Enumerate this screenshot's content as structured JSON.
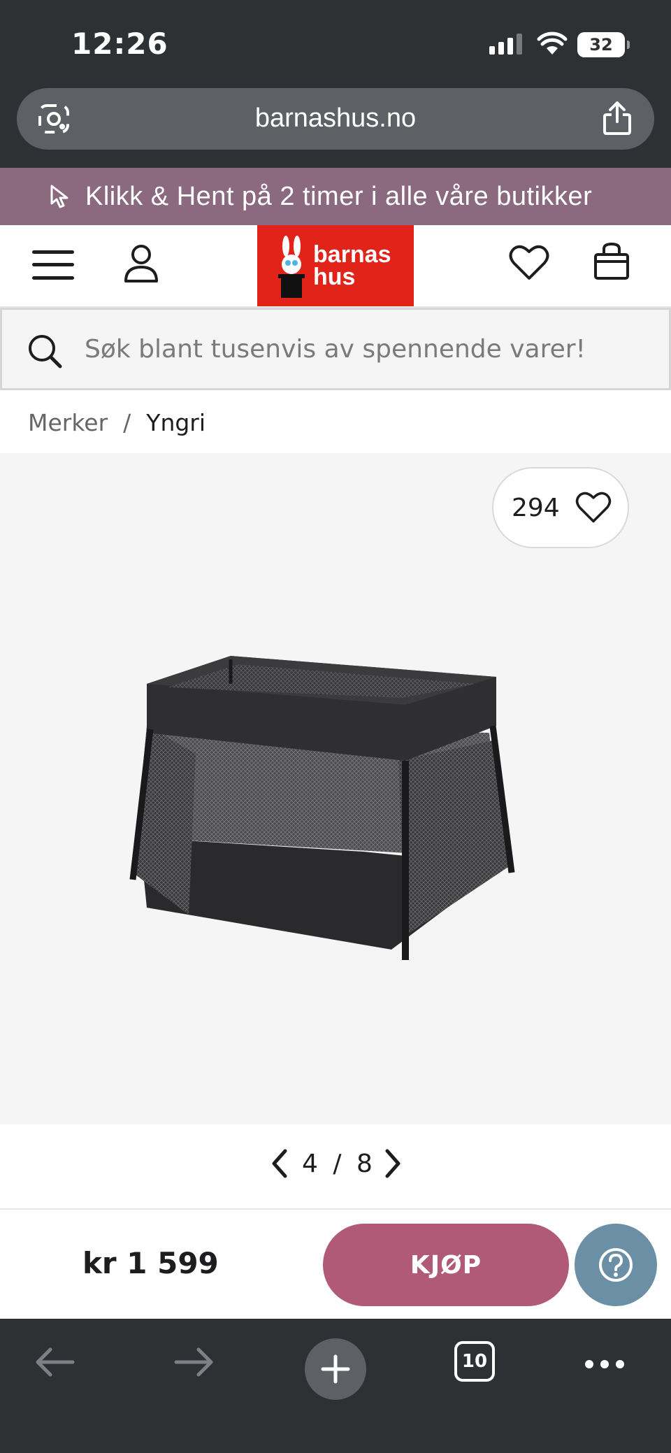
{
  "status_bar": {
    "time": "12:26",
    "battery": "32",
    "icons": [
      "signal-icon",
      "wifi-icon",
      "battery-icon"
    ]
  },
  "browser": {
    "url": "barnashus.no",
    "open_tabs": "10"
  },
  "promo": {
    "text": "Klikk & Hent på 2 timer i alle våre butikker"
  },
  "header": {
    "logo_line1": "barnas",
    "logo_line2": "hus",
    "brand_color": "#e2231a"
  },
  "search": {
    "placeholder": "Søk blant tusenvis av spennende varer!"
  },
  "breadcrumb": {
    "items": [
      "Merker",
      "Yngri"
    ],
    "separator": "/"
  },
  "gallery": {
    "favorites_count": "294",
    "current_page": "4",
    "separator": "/",
    "total_pages": "8"
  },
  "purchase": {
    "price": "kr 1 599",
    "buy_label": "KJØP",
    "buy_color": "#b05a78",
    "help_color": "#6b8fa5"
  },
  "colors": {
    "promo_bg": "#8b6a80",
    "chrome_bg": "#2e3134"
  }
}
